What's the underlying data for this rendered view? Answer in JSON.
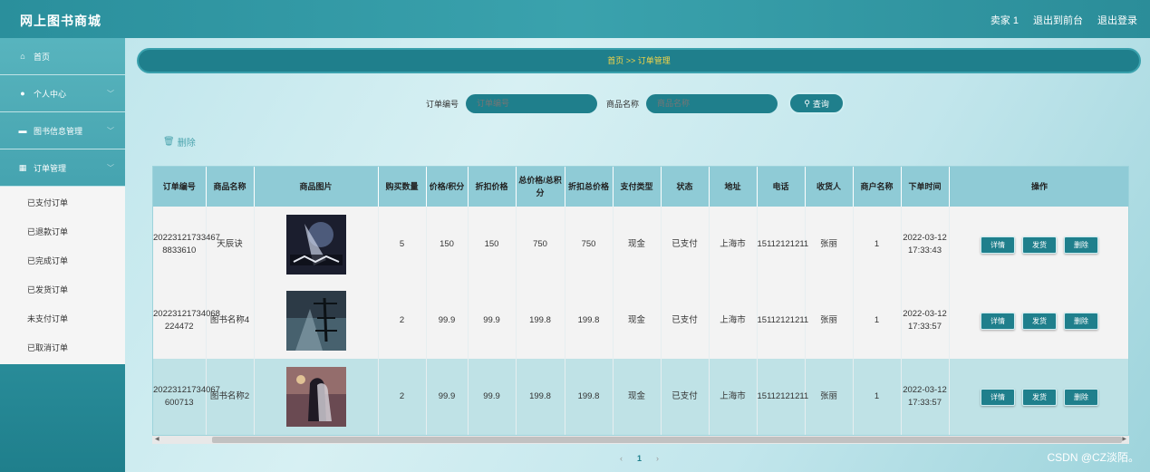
{
  "app": {
    "title": "网上图书商城"
  },
  "header": {
    "user": "卖家 1",
    "back_label": "退出到前台",
    "logout_label": "退出登录"
  },
  "sidebar": {
    "items": [
      {
        "label": "首页",
        "icon": "home-icon"
      },
      {
        "label": "个人中心",
        "icon": "user-icon"
      },
      {
        "label": "图书信息管理",
        "icon": "briefcase-icon"
      },
      {
        "label": "订单管理",
        "icon": "grid-icon"
      }
    ],
    "submenu": [
      "已支付订单",
      "已退款订单",
      "已完成订单",
      "已发货订单",
      "未支付订单",
      "已取消订单"
    ]
  },
  "breadcrumb": "首页 >> 订单管理",
  "search": {
    "order_label": "订单编号",
    "order_placeholder": "订单编号",
    "name_label": "商品名称",
    "name_placeholder": "商品名称",
    "button": "查询"
  },
  "delete_label": "删除",
  "table": {
    "headers": [
      "订单编号",
      "商品名称",
      "商品图片",
      "购买数量",
      "价格/积分",
      "折扣价格",
      "总价格/总积分",
      "折扣总价格",
      "支付类型",
      "状态",
      "地址",
      "电话",
      "收货人",
      "商户名称",
      "下单时间",
      "操作"
    ],
    "rows": [
      {
        "order_no": "20223121733467 8833610",
        "name": "天辰诀",
        "qty": "5",
        "price": "150",
        "discount": "150",
        "total": "750",
        "discount_total": "750",
        "pay": "现金",
        "status": "已支付",
        "address": "上海市",
        "phone": "15112121211",
        "receiver": "张丽",
        "merchant": "1",
        "time": "2022-03-12 17:33:43"
      },
      {
        "order_no": "20223121734068 224472",
        "name": "图书名称4",
        "qty": "2",
        "price": "99.9",
        "discount": "99.9",
        "total": "199.8",
        "discount_total": "199.8",
        "pay": "现金",
        "status": "已支付",
        "address": "上海市",
        "phone": "15112121211",
        "receiver": "张丽",
        "merchant": "1",
        "time": "2022-03-12 17:33:57"
      },
      {
        "order_no": "20223121734067 600713",
        "name": "图书名称2",
        "qty": "2",
        "price": "99.9",
        "discount": "99.9",
        "total": "199.8",
        "discount_total": "199.8",
        "pay": "现金",
        "status": "已支付",
        "address": "上海市",
        "phone": "15112121211",
        "receiver": "张丽",
        "merchant": "1",
        "time": "2022-03-12 17:33:57"
      }
    ],
    "actions": {
      "detail": "详情",
      "ship": "发货",
      "delete": "删除"
    }
  },
  "pager": {
    "prev": "‹",
    "current": "1",
    "next": "›"
  },
  "watermark": "CSDN @CZ淡陌。",
  "colors": {
    "accent": "#1f7f8c",
    "header": "#3aa2ad",
    "crumb_text": "#f5d547"
  }
}
